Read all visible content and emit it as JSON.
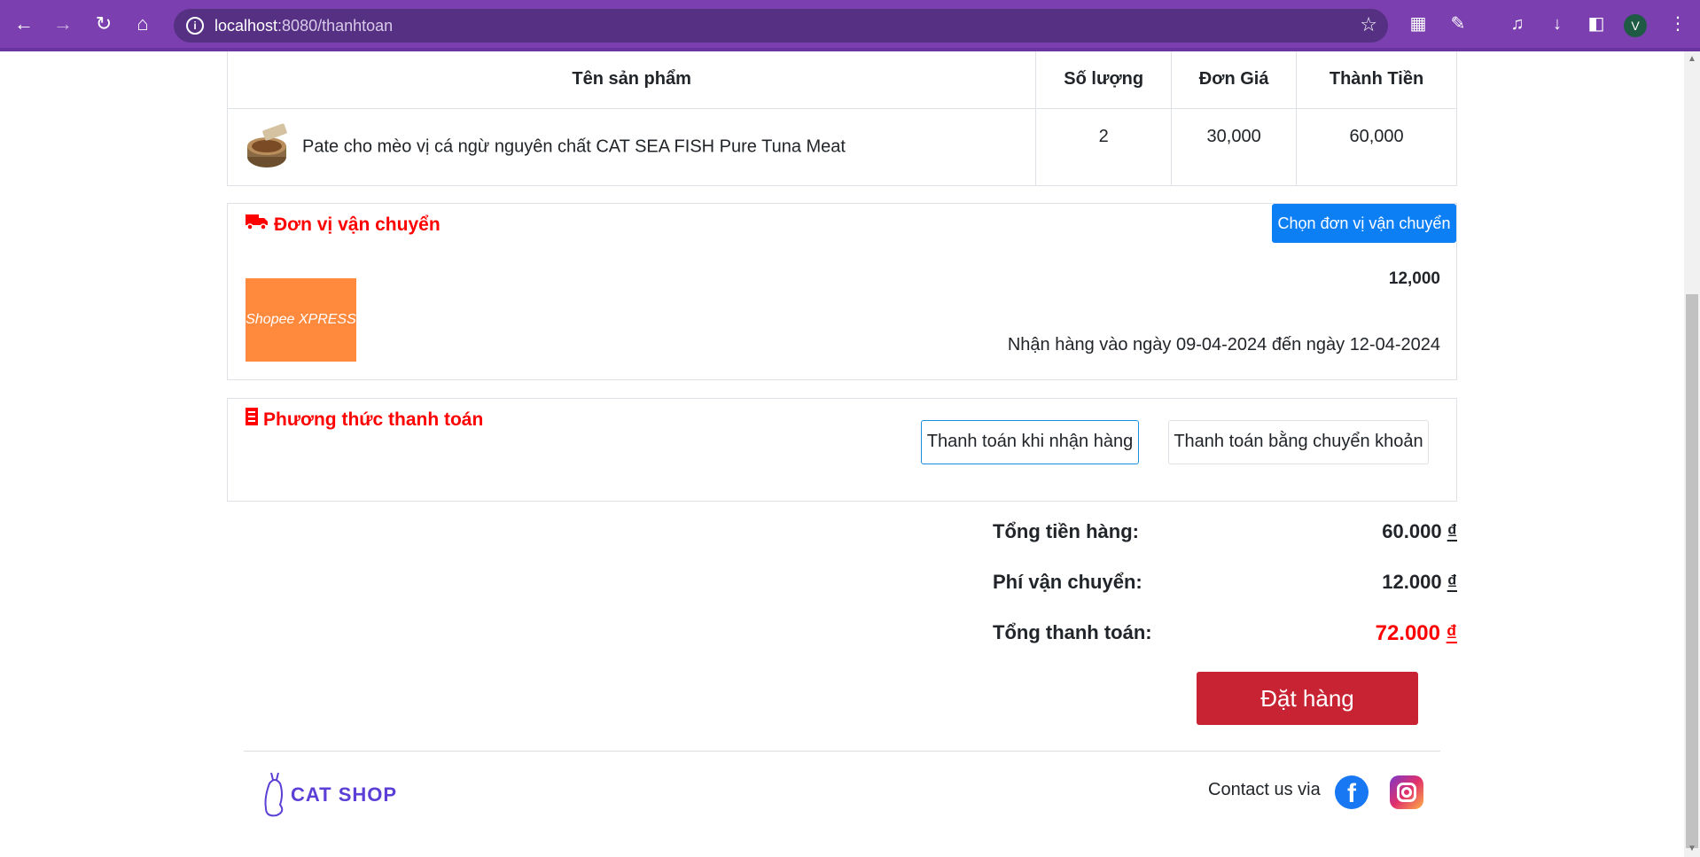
{
  "browser": {
    "url_host": "localhost",
    "url_path": ":8080/thanhtoan",
    "profile_initial": "V"
  },
  "table": {
    "headers": [
      "Tên sản phẩm",
      "Số lượng",
      "Đơn Giá",
      "Thành Tiền"
    ],
    "rows": [
      {
        "name": "Pate cho mèo vị cá ngừ nguyên chất CAT SEA FISH Pure Tuna Meat",
        "qty": "2",
        "price": "30,000",
        "total": "60,000"
      }
    ]
  },
  "shipping": {
    "title": "Đơn vị vận chuyển",
    "choose_button": "Chọn đơn vị vận chuyển",
    "carrier_logo_text": "Shopee XPRESS",
    "fee": "12,000",
    "delivery_text": "Nhận hàng vào ngày 09-04-2024 đến ngày 12-04-2024"
  },
  "payment": {
    "title": "Phương thức thanh toán",
    "options": [
      "Thanh toán khi nhận hàng",
      "Thanh toán bằng chuyển khoản"
    ]
  },
  "summary": {
    "subtotal_label": "Tổng tiền hàng:",
    "subtotal_value": "60.000",
    "shipping_label": "Phí vận chuyển:",
    "shipping_value": "12.000",
    "total_label": "Tổng thanh toán:",
    "total_value": "72.000",
    "currency": "₫"
  },
  "order_button": "Đặt hàng",
  "footer": {
    "logo_text": "CAT SHOP",
    "contact_text": "Contact us via"
  },
  "colors": {
    "chrome": "#7b3fb0",
    "accent_red": "#ff0000",
    "order_button": "#c82333",
    "choose_button": "#0d7ff5"
  }
}
